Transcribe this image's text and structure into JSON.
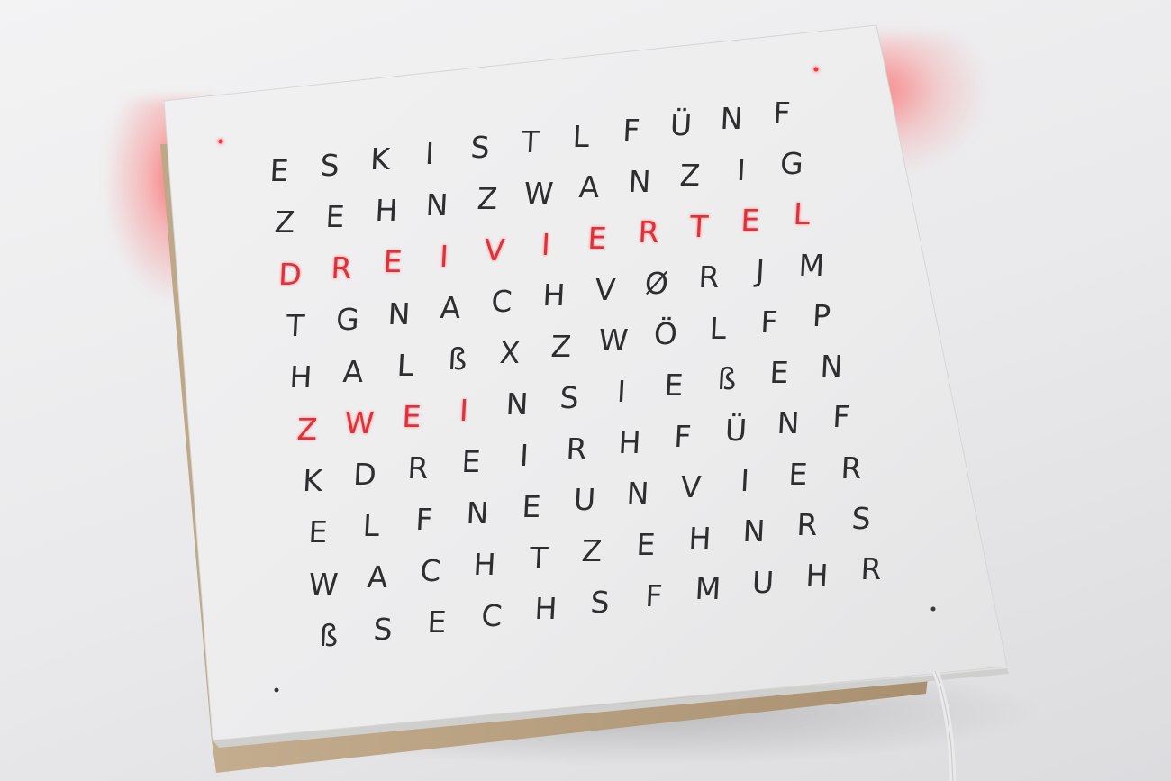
{
  "clock": {
    "lit_words": [
      "DREIVIERTEL",
      "ZWEI"
    ],
    "rows": [
      {
        "letters": [
          "E",
          "S",
          "K",
          "I",
          "S",
          "T",
          "L",
          "F",
          "Ü",
          "N",
          "F"
        ],
        "lit": [
          0,
          0,
          0,
          0,
          0,
          0,
          0,
          0,
          0,
          0,
          0
        ]
      },
      {
        "letters": [
          "Z",
          "E",
          "H",
          "N",
          "Z",
          "W",
          "A",
          "N",
          "Z",
          "I",
          "G"
        ],
        "lit": [
          0,
          0,
          0,
          0,
          0,
          0,
          0,
          0,
          0,
          0,
          0
        ]
      },
      {
        "letters": [
          "D",
          "R",
          "E",
          "I",
          "V",
          "I",
          "E",
          "R",
          "T",
          "E",
          "L"
        ],
        "lit": [
          1,
          1,
          1,
          1,
          1,
          1,
          1,
          1,
          1,
          1,
          1
        ]
      },
      {
        "letters": [
          "T",
          "G",
          "N",
          "A",
          "C",
          "H",
          "V",
          "Ø",
          "R",
          "J",
          "M"
        ],
        "lit": [
          0,
          0,
          0,
          0,
          0,
          0,
          0,
          0,
          0,
          0,
          0
        ]
      },
      {
        "letters": [
          "H",
          "A",
          "L",
          "ß",
          "X",
          "Z",
          "W",
          "Ö",
          "L",
          "F",
          "P"
        ],
        "lit": [
          0,
          0,
          0,
          0,
          0,
          0,
          0,
          0,
          0,
          0,
          0
        ]
      },
      {
        "letters": [
          "Z",
          "W",
          "E",
          "I",
          "N",
          "S",
          "I",
          "E",
          "ß",
          "E",
          "N"
        ],
        "lit": [
          1,
          1,
          1,
          1,
          0,
          0,
          0,
          0,
          0,
          0,
          0
        ]
      },
      {
        "letters": [
          "K",
          "D",
          "R",
          "E",
          "I",
          "R",
          "H",
          "F",
          "Ü",
          "N",
          "F"
        ],
        "lit": [
          0,
          0,
          0,
          0,
          0,
          0,
          0,
          0,
          0,
          0,
          0
        ]
      },
      {
        "letters": [
          "E",
          "L",
          "F",
          "N",
          "E",
          "U",
          "N",
          "V",
          "I",
          "E",
          "R"
        ],
        "lit": [
          0,
          0,
          0,
          0,
          0,
          0,
          0,
          0,
          0,
          0,
          0
        ]
      },
      {
        "letters": [
          "W",
          "A",
          "C",
          "H",
          "T",
          "Z",
          "E",
          "H",
          "N",
          "R",
          "S"
        ],
        "lit": [
          0,
          0,
          0,
          0,
          0,
          0,
          0,
          0,
          0,
          0,
          0
        ]
      },
      {
        "letters": [
          "ß",
          "S",
          "E",
          "C",
          "H",
          "S",
          "F",
          "M",
          "U",
          "H",
          "R"
        ],
        "lit": [
          0,
          0,
          0,
          0,
          0,
          0,
          0,
          0,
          0,
          0,
          0
        ]
      }
    ]
  },
  "colors": {
    "background": "#eaeaec",
    "board_face": "#efeff0",
    "board_edge": "#d9d8d6",
    "mdf_back": "#b8a080",
    "letter_off": "#2e2e30",
    "letter_lit": "#e0303a",
    "glow": "#ff3c3c"
  }
}
